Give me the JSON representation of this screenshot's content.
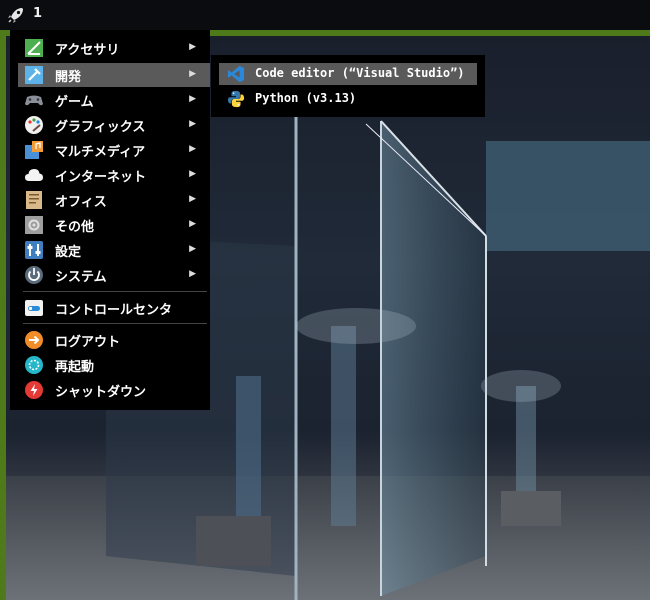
{
  "topbar": {
    "workspace": "1",
    "launcher_icon": "rocket-icon"
  },
  "menu": {
    "items": [
      {
        "label": "アクセサリ",
        "icon": "accessories-icon",
        "submenu": true
      },
      {
        "label": "開発",
        "icon": "development-icon",
        "submenu": true,
        "active": true
      },
      {
        "label": "ゲーム",
        "icon": "gamepad-icon",
        "submenu": true
      },
      {
        "label": "グラフィックス",
        "icon": "graphics-icon",
        "submenu": true
      },
      {
        "label": "マルチメディア",
        "icon": "multimedia-icon",
        "submenu": true
      },
      {
        "label": "インターネット",
        "icon": "cloud-icon",
        "submenu": true
      },
      {
        "label": "オフィス",
        "icon": "office-icon",
        "submenu": true
      },
      {
        "label": "その他",
        "icon": "other-icon",
        "submenu": true
      },
      {
        "label": "設定",
        "icon": "settings-icon",
        "submenu": true
      },
      {
        "label": "システム",
        "icon": "system-icon",
        "submenu": true
      },
      {
        "label": "コントロールセンタ",
        "icon": "control-center-icon"
      },
      {
        "label": "ログアウト",
        "icon": "logout-icon"
      },
      {
        "label": "再起動",
        "icon": "restart-icon"
      },
      {
        "label": "シャットダウン",
        "icon": "shutdown-icon"
      }
    ],
    "submenu_arrow": "▶"
  },
  "submenu": {
    "items": [
      {
        "label": "Code editor (“Visual Studio”)",
        "icon": "vscode-icon",
        "active": true
      },
      {
        "label": "Python (v3.13)",
        "icon": "python-icon"
      }
    ]
  },
  "colors": {
    "desktop_border": "#4f7a1a",
    "menu_bg": "#000000",
    "highlight": "#5a5a5a"
  }
}
